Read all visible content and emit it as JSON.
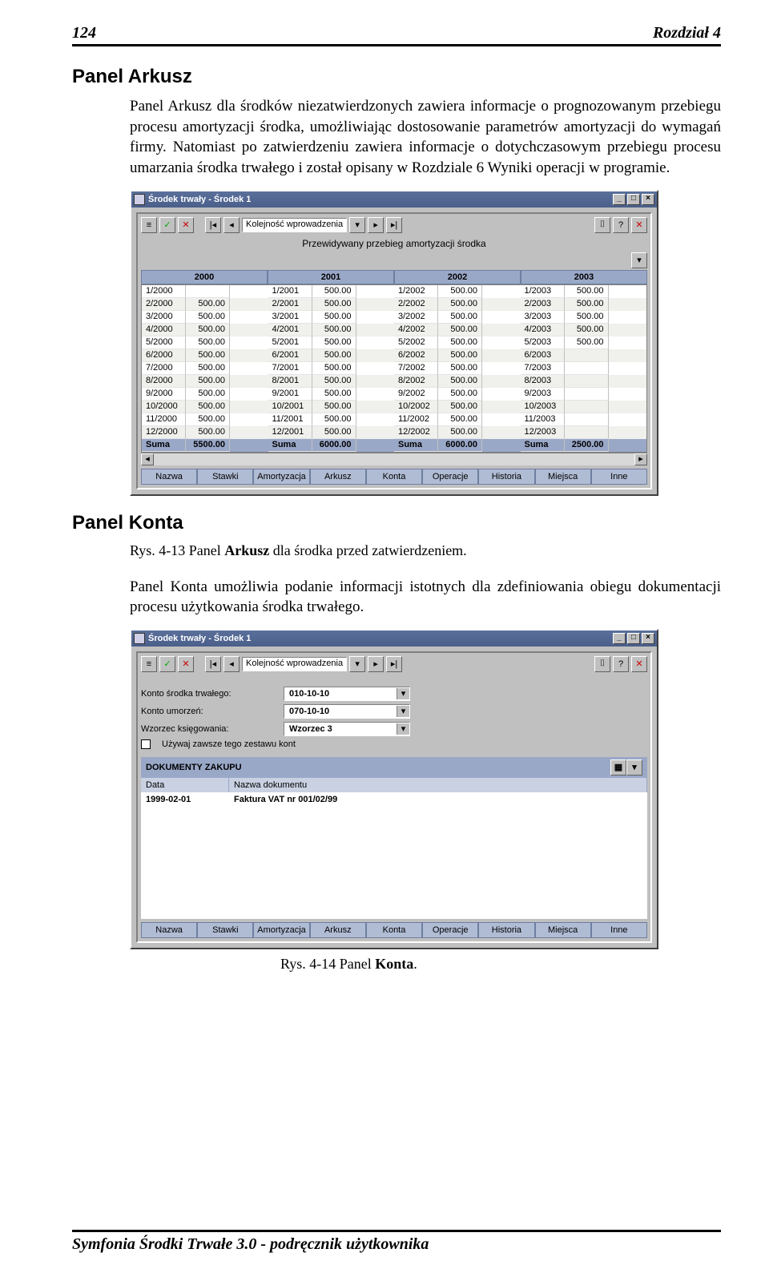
{
  "page_header": {
    "num": "124",
    "chapter": "Rozdział 4"
  },
  "section1_title": "Panel Arkusz",
  "section1_body": "Panel Arkusz dla środków niezatwierdzonych zawiera informacje o prognozowanym przebiegu procesu amortyzacji środka, umożliwiając dostosowanie parametrów amortyzacji do wymagań firmy. Natomiast po zatwierdzeniu zawiera informacje o dotychczasowym przebiegu procesu umarzania środka trwałego i został opisany w Rozdziale 6 Wyniki operacji w programie.",
  "section2_title": "Panel Konta",
  "caption1_prefix": "Rys. 4-13 Panel ",
  "caption1_bold": "Arkusz",
  "caption1_suffix": " dla środka przed zatwierdzeniem.",
  "section2_body": "Panel Konta umożliwia podanie informacji istotnych dla zdefiniowania obiegu dokumentacji procesu użytkowania środka trwałego.",
  "caption2_prefix": "Rys. 4-14 Panel ",
  "caption2_bold": "Konta",
  "caption2_suffix": ".",
  "footer": "Symfonia Środki Trwałe 3.0 - podręcznik użytkownika",
  "win_title": "Środek trwały - Środek 1",
  "order_label": "Kolejność wprowadzenia",
  "qmark": "?",
  "grid_subtitle": "Przewidywany przebieg amortyzacji środka",
  "years": [
    "2000",
    "2001",
    "2002",
    "2003"
  ],
  "sum_label": "Suma",
  "sums": [
    "5500.00",
    "6000.00",
    "6000.00",
    "2500.00"
  ],
  "months": [
    {
      "r0": "1/2000",
      "r1": "1/2001",
      "v1": "500.00",
      "r2": "1/2002",
      "v2": "500.00",
      "r3": "1/2003",
      "v3": "500.00"
    },
    {
      "r0": "2/2000",
      "v0": "500.00",
      "r1": "2/2001",
      "v1": "500.00",
      "r2": "2/2002",
      "v2": "500.00",
      "r3": "2/2003",
      "v3": "500.00"
    },
    {
      "r0": "3/2000",
      "v0": "500.00",
      "r1": "3/2001",
      "v1": "500.00",
      "r2": "3/2002",
      "v2": "500.00",
      "r3": "3/2003",
      "v3": "500.00"
    },
    {
      "r0": "4/2000",
      "v0": "500.00",
      "r1": "4/2001",
      "v1": "500.00",
      "r2": "4/2002",
      "v2": "500.00",
      "r3": "4/2003",
      "v3": "500.00"
    },
    {
      "r0": "5/2000",
      "v0": "500.00",
      "r1": "5/2001",
      "v1": "500.00",
      "r2": "5/2002",
      "v2": "500.00",
      "r3": "5/2003",
      "v3": "500.00"
    },
    {
      "r0": "6/2000",
      "v0": "500.00",
      "r1": "6/2001",
      "v1": "500.00",
      "r2": "6/2002",
      "v2": "500.00",
      "r3": "6/2003",
      "v3": ""
    },
    {
      "r0": "7/2000",
      "v0": "500.00",
      "r1": "7/2001",
      "v1": "500.00",
      "r2": "7/2002",
      "v2": "500.00",
      "r3": "7/2003",
      "v3": ""
    },
    {
      "r0": "8/2000",
      "v0": "500.00",
      "r1": "8/2001",
      "v1": "500.00",
      "r2": "8/2002",
      "v2": "500.00",
      "r3": "8/2003",
      "v3": ""
    },
    {
      "r0": "9/2000",
      "v0": "500.00",
      "r1": "9/2001",
      "v1": "500.00",
      "r2": "9/2002",
      "v2": "500.00",
      "r3": "9/2003",
      "v3": ""
    },
    {
      "r0": "10/2000",
      "v0": "500.00",
      "r1": "10/2001",
      "v1": "500.00",
      "r2": "10/2002",
      "v2": "500.00",
      "r3": "10/2003",
      "v3": ""
    },
    {
      "r0": "11/2000",
      "v0": "500.00",
      "r1": "11/2001",
      "v1": "500.00",
      "r2": "11/2002",
      "v2": "500.00",
      "r3": "11/2003",
      "v3": ""
    },
    {
      "r0": "12/2000",
      "v0": "500.00",
      "r1": "12/2001",
      "v1": "500.00",
      "r2": "12/2002",
      "v2": "500.00",
      "r3": "12/2003",
      "v3": ""
    }
  ],
  "tabs": [
    "Nazwa",
    "Stawki",
    "Amortyzacja",
    "Arkusz",
    "Konta",
    "Operacje",
    "Historia",
    "Miejsca",
    "Inne"
  ],
  "form": {
    "konto_srodka_lab": "Konto środka trwałego:",
    "konto_srodka_val": "010-10-10",
    "konto_umorzen_lab": "Konto umorzeń:",
    "konto_umorzen_val": "070-10-10",
    "wzorzec_lab": "Wzorzec księgowania:",
    "wzorzec_val": "Wzorzec 3",
    "checkbox_lab": "Używaj zawsze tego zestawu kont",
    "section_title": "DOKUMENTY ZAKUPU",
    "col_data": "Data",
    "col_nazwa": "Nazwa dokumentu",
    "row_data": "1999-02-01",
    "row_nazwa": "Faktura VAT nr 001/02/99"
  }
}
